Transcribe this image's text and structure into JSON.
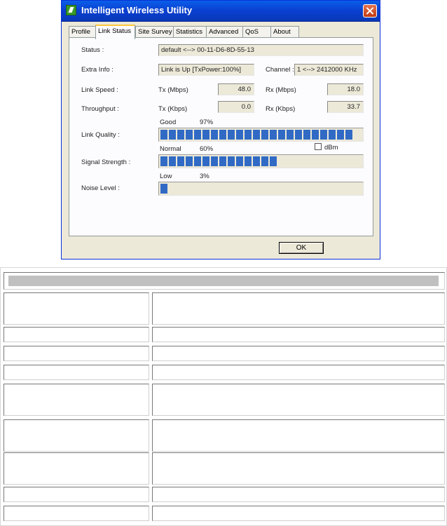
{
  "window": {
    "title": "Intelligent Wireless Utility",
    "title_bar_color": "#0a4fd8"
  },
  "tabs": [
    {
      "label": "Profile"
    },
    {
      "label": "Link Status"
    },
    {
      "label": "Site Survey"
    },
    {
      "label": "Statistics"
    },
    {
      "label": "Advanced"
    },
    {
      "label": "QoS"
    },
    {
      "label": "About"
    }
  ],
  "link_status": {
    "status_label": "Status :",
    "status_value": "default <--> 00-11-D6-8D-55-13",
    "extra_info_label": "Extra Info :",
    "extra_info_value": "Link is Up [TxPower:100%]",
    "channel_label": "Channel :",
    "channel_value": "1 <--> 2412000 KHz",
    "link_speed_label": "Link Speed :",
    "tx_mbps_label": "Tx (Mbps)",
    "tx_mbps_value": "48.0",
    "rx_mbps_label": "Rx (Mbps)",
    "rx_mbps_value": "18.0",
    "throughput_label": "Throughput :",
    "tx_kbps_label": "Tx (Kbps)",
    "tx_kbps_value": "0.0",
    "rx_kbps_label": "Rx (Kbps)",
    "rx_kbps_value": "33.7",
    "link_quality_label": "Link Quality :",
    "link_quality_text": "Good",
    "link_quality_pct": "97%",
    "link_quality_level": 0.97,
    "dbm_label": "dBm",
    "signal_strength_label": "Signal Strength :",
    "signal_text": "Normal",
    "signal_pct": "60%",
    "signal_level": 0.6,
    "noise_level_label": "Noise Level :",
    "noise_text": "Low",
    "noise_pct": "3%",
    "noise_level": 0.03,
    "bar_color": "#316ac5"
  },
  "buttons": {
    "ok_label": "OK"
  }
}
